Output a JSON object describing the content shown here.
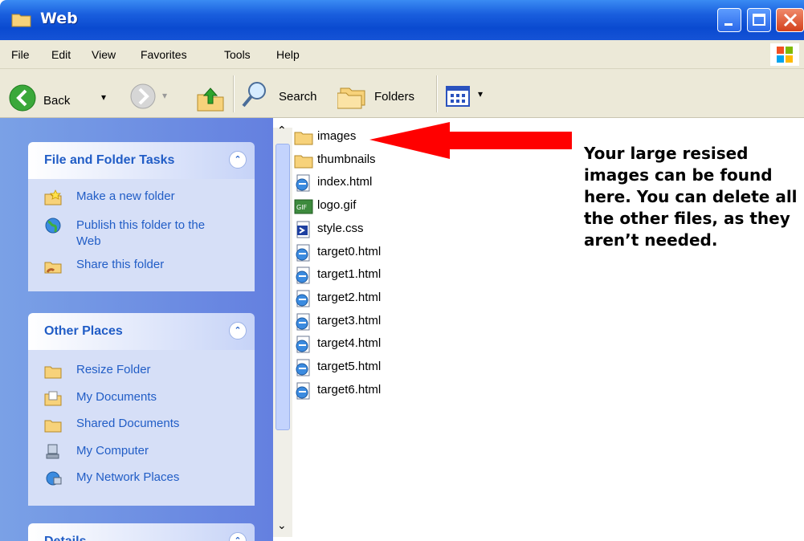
{
  "window": {
    "title": "Web"
  },
  "menu": [
    "File",
    "Edit",
    "View",
    "Favorites",
    "Tools",
    "Help"
  ],
  "toolbar": {
    "back": "Back",
    "search": "Search",
    "folders": "Folders"
  },
  "file_folder_tasks": {
    "title": "File and Folder Tasks",
    "items": [
      "Make a new folder",
      "Publish this folder to the Web",
      "Share this folder"
    ]
  },
  "other_places": {
    "title": "Other Places",
    "items": [
      "Resize Folder",
      "My Documents",
      "Shared Documents",
      "My Computer",
      "My Network Places"
    ]
  },
  "details": {
    "title": "Details"
  },
  "files": [
    "images",
    "thumbnails",
    "index.html",
    "logo.gif",
    "style.css",
    "target0.html",
    "target1.html",
    "target2.html",
    "target3.html",
    "target4.html",
    "target5.html",
    "target6.html"
  ],
  "annotation": "Your large resised images can be found here. You can delete all the other files, as they aren’t needed.",
  "colors": {
    "titlebar": "#0a4ad0",
    "task_link": "#215dc6",
    "arrow": "#ff0000",
    "pane": "#6480e0"
  }
}
